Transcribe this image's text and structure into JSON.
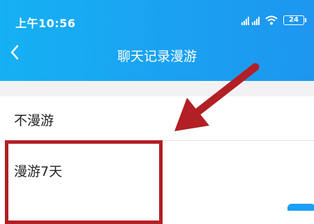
{
  "status_bar": {
    "time": "上午10:56",
    "battery": "24"
  },
  "nav": {
    "title": "聊天记录漫游"
  },
  "options": [
    {
      "label": "不漫游"
    },
    {
      "label": "漫游7天"
    }
  ],
  "colors": {
    "header": "#1aa4f2",
    "annotation": "#b21f24"
  },
  "icons": [
    "back-arrow-icon",
    "signal-icon",
    "wifi-icon",
    "battery-icon"
  ]
}
